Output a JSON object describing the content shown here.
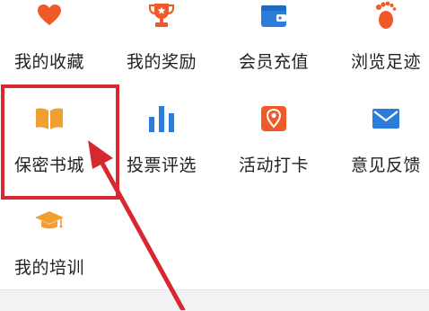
{
  "menu": {
    "items": [
      {
        "key": "favorites",
        "label": "我的收藏",
        "icon": "heart-icon",
        "color": "#f05a28"
      },
      {
        "key": "rewards",
        "label": "我的奖励",
        "icon": "trophy-icon",
        "color": "#f05a28"
      },
      {
        "key": "recharge",
        "label": "会员充值",
        "icon": "wallet-icon",
        "color": "#2a7ed9"
      },
      {
        "key": "history",
        "label": "浏览足迹",
        "icon": "footprint-icon",
        "color": "#f05a28"
      },
      {
        "key": "bookstore",
        "label": "保密书城",
        "icon": "book-icon",
        "color": "#f0a030"
      },
      {
        "key": "vote",
        "label": "投票评选",
        "icon": "bar-chart-icon",
        "color": "#2a7ed9"
      },
      {
        "key": "checkin",
        "label": "活动打卡",
        "icon": "location-pin-icon",
        "color": "#f05a28"
      },
      {
        "key": "feedback",
        "label": "意见反馈",
        "icon": "mail-icon",
        "color": "#2a7ed9"
      },
      {
        "key": "training",
        "label": "我的培训",
        "icon": "graduation-cap-icon",
        "color": "#f0a030"
      }
    ]
  },
  "annotation": {
    "highlight_color": "#d8282f",
    "arrow_color": "#d8282f"
  }
}
